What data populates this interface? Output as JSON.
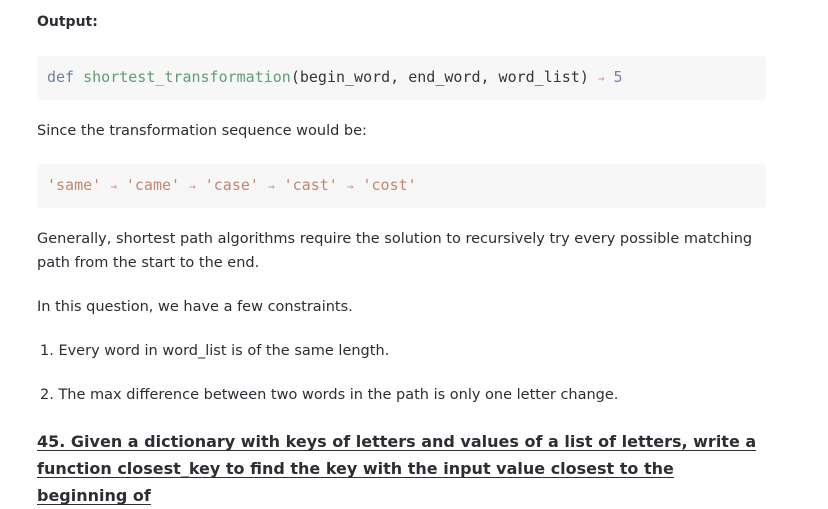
{
  "output_label": "Output:",
  "code_block_1": {
    "keyword": "def",
    "function_name": "shortest_transformation",
    "args": "(begin_word, end_word, word_list)",
    "arrow": "→",
    "result": "5"
  },
  "paragraph_1": "Since the transformation sequence would be:",
  "code_block_2": {
    "words": [
      "'same'",
      "'came'",
      "'case'",
      "'cast'",
      "'cost'"
    ],
    "arrow": "→"
  },
  "paragraph_2": "Generally, shortest path algorithms require the solution to recursively try every possible matching path from the start to the end.",
  "paragraph_3": "In this question, we have a few constraints.",
  "list": [
    "1. Every word in word_list is of the same length.",
    "2. The max difference between two words in the path is only one letter change."
  ],
  "heading": "45. Given a dictionary with keys of letters and values of a list of letters, write a function closest_key to find the key with the input value closest to the beginning of"
}
